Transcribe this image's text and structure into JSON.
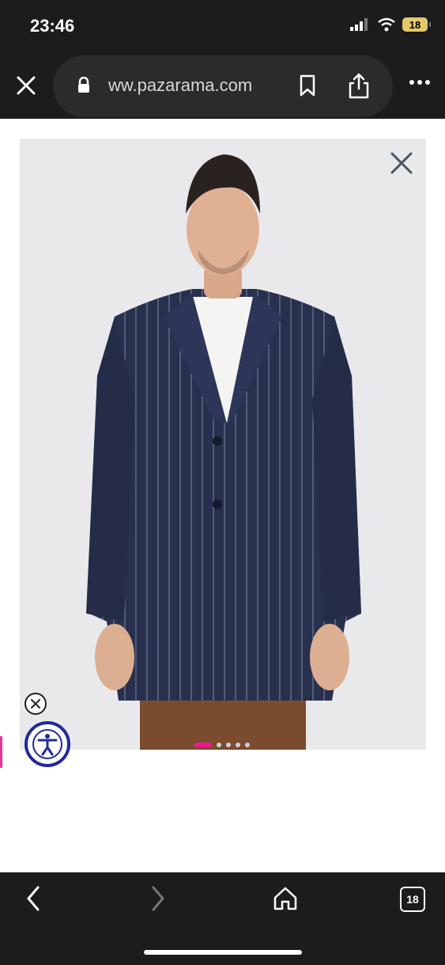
{
  "status": {
    "time": "23:46",
    "battery": "18"
  },
  "browser": {
    "url": "ww.pazarama.com",
    "tabs_count": "18"
  },
  "gallery": {
    "slides": 5,
    "active_slide": 1,
    "accent_color": "#ea1a8d"
  },
  "icons": {
    "close": "close-icon",
    "lock": "lock-icon",
    "bookmark": "bookmark-icon",
    "share": "share-icon",
    "more": "more-icon",
    "accessibility": "accessibility-icon",
    "back": "back-icon",
    "forward": "forward-icon",
    "home": "home-icon"
  },
  "colors": {
    "browser_bg": "#1c1c1e",
    "accessibility_blue": "#1f2a9b"
  }
}
